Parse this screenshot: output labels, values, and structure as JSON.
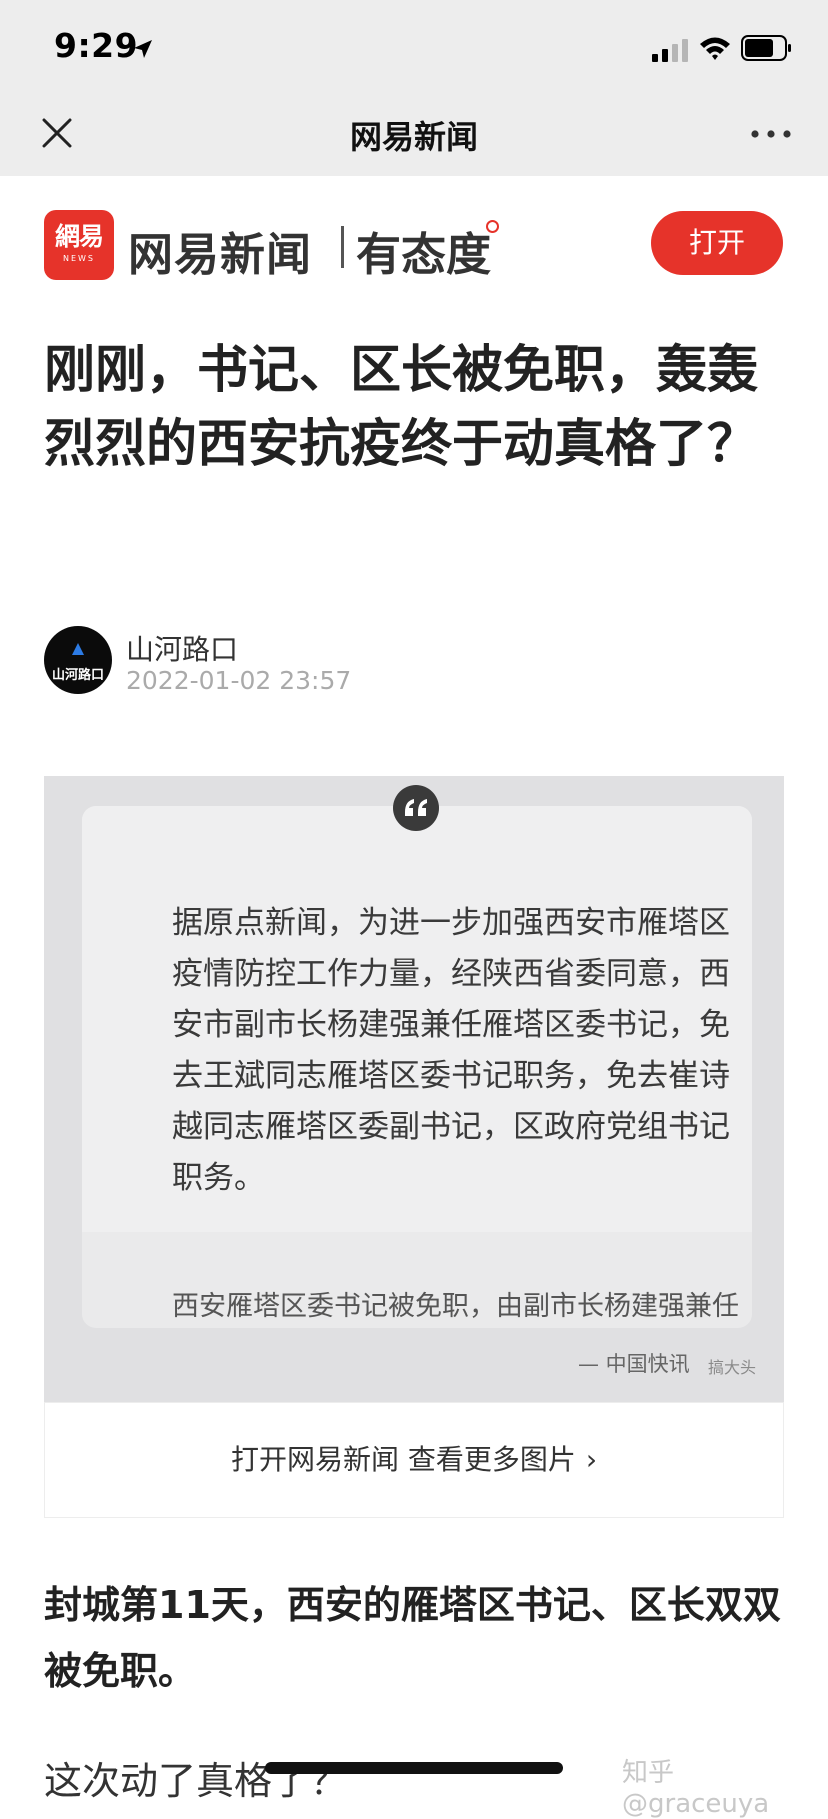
{
  "status_bar": {
    "time": "9:29",
    "icons": [
      "location-arrow-icon",
      "signal-bars-icon",
      "wifi-icon",
      "battery-icon"
    ]
  },
  "nav": {
    "title": "网易新闻",
    "icons": [
      "close-icon",
      "more-icon"
    ]
  },
  "banner": {
    "logo_main": "網易",
    "logo_sub": "NEWS",
    "app_name": "网易新闻",
    "slogan": "有态度",
    "open_label": "打开",
    "accent_color": "#e6332a"
  },
  "article": {
    "title": "刚刚，书记、区长被免职，轰轰烈烈的西安抗疫终于动真格了？",
    "author": {
      "avatar_text": "山河路口",
      "name": "山河路口",
      "time": "2022-01-02 23:57"
    },
    "image_card": {
      "quote_icon": "quote-mark-icon",
      "quote_text": "据原点新闻，为进一步加强西安市雁塔区疫情防控工作力量，经陕西省委同意，西安市副市长杨建强兼任雁塔区委书记，免去王斌同志雁塔区委书记职务，免去崔诗越同志雁塔区委副书记，区政府党组书记职务。",
      "caption": "西安雁塔区委书记被免职，由副市长杨建强兼任",
      "source": "— 中国快讯",
      "watermark": "搞大头",
      "footer_label": "打开网易新闻 查看更多图片",
      "footer_chevron": "›"
    },
    "paragraph_1": "封城第11天，西安的雁塔区书记、区长双双被免职。",
    "paragraph_2": "这次动了真格了？"
  },
  "watermark": "知乎 @graceuya"
}
